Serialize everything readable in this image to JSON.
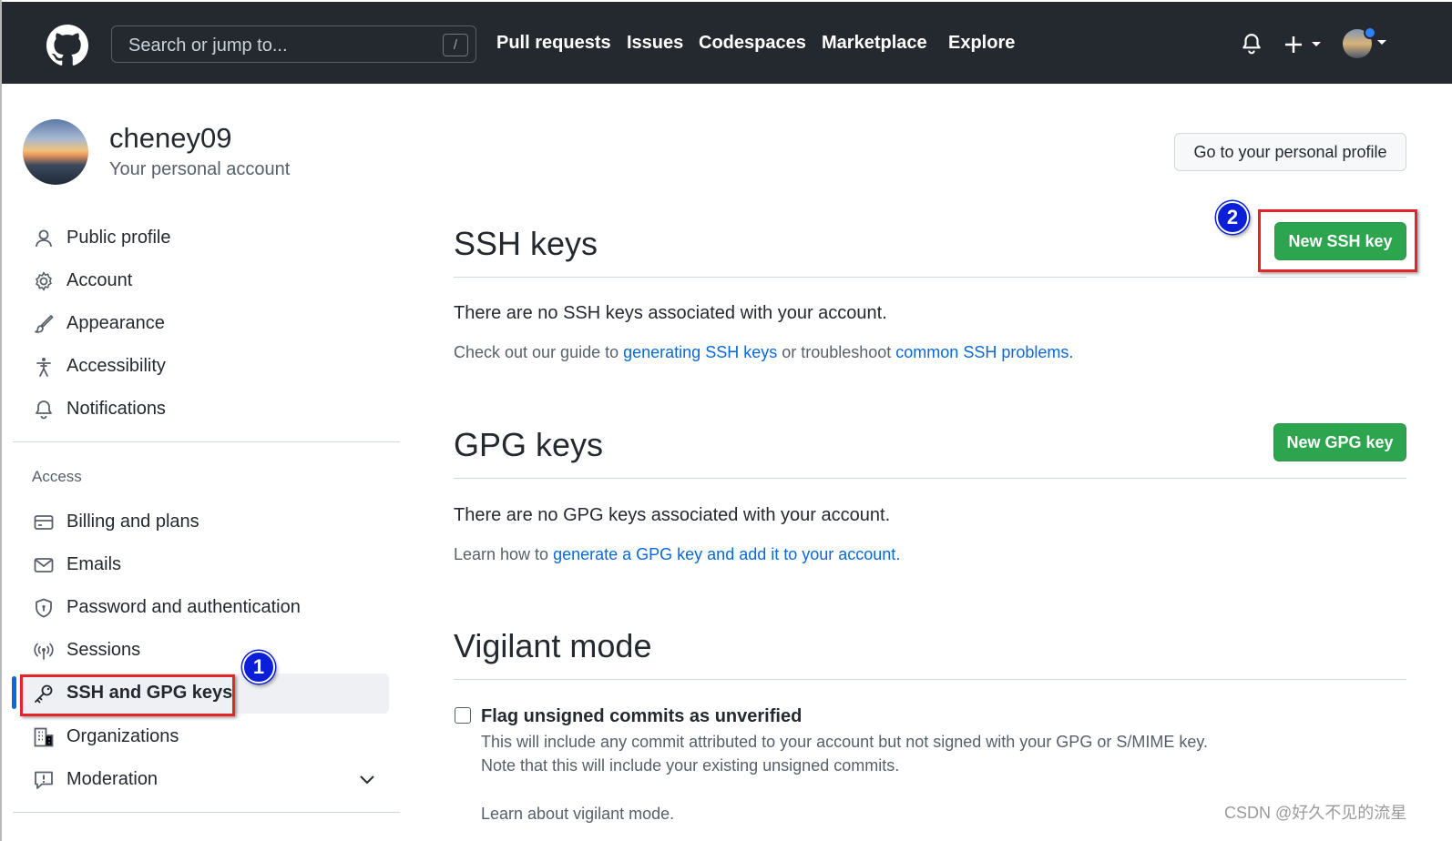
{
  "header": {
    "search_placeholder": "Search or jump to...",
    "search_shortcut": "/",
    "nav": [
      "Pull requests",
      "Issues",
      "Codespaces",
      "Marketplace",
      "Explore"
    ]
  },
  "profile": {
    "username": "cheney09",
    "subtitle": "Your personal account",
    "profile_button": "Go to your personal profile"
  },
  "sidebar": {
    "items": [
      {
        "label": "Public profile",
        "icon": "person-icon"
      },
      {
        "label": "Account",
        "icon": "gear-icon"
      },
      {
        "label": "Appearance",
        "icon": "paintbrush-icon"
      },
      {
        "label": "Accessibility",
        "icon": "accessibility-icon"
      },
      {
        "label": "Notifications",
        "icon": "bell-icon"
      }
    ],
    "section_access": "Access",
    "access_items": [
      {
        "label": "Billing and plans",
        "icon": "credit-card-icon"
      },
      {
        "label": "Emails",
        "icon": "mail-icon"
      },
      {
        "label": "Password and authentication",
        "icon": "shield-icon"
      },
      {
        "label": "Sessions",
        "icon": "broadcast-icon"
      },
      {
        "label": "SSH and GPG keys",
        "icon": "key-icon",
        "active": true
      },
      {
        "label": "Organizations",
        "icon": "organization-icon"
      },
      {
        "label": "Moderation",
        "icon": "report-icon"
      }
    ]
  },
  "ssh": {
    "title": "SSH keys",
    "new_button": "New SSH key",
    "empty": "There are no SSH keys associated with your account.",
    "guide_prefix": "Check out our guide to ",
    "guide_link1": "generating SSH keys",
    "guide_middle": " or troubleshoot ",
    "guide_link2": "common SSH problems",
    "guide_suffix": "."
  },
  "gpg": {
    "title": "GPG keys",
    "new_button": "New GPG key",
    "empty": "There are no GPG keys associated with your account.",
    "learn_prefix": "Learn how to ",
    "learn_link": "generate a GPG key and add it to your account",
    "learn_suffix": "."
  },
  "vigilant": {
    "title": "Vigilant mode",
    "checkbox_label": "Flag unsigned commits as unverified",
    "note1": "This will include any commit attributed to your account but not signed with your GPG or S/MIME key.",
    "note2": "Note that this will include your existing unsigned commits.",
    "learn_link": "Learn about vigilant mode."
  },
  "annotations": {
    "badge1": "1",
    "badge2": "2"
  },
  "watermark": "CSDN @好久不见的流星",
  "colors": {
    "header_bg": "#24292f",
    "green": "#2da44e",
    "link": "#0969da",
    "annotation_red": "#e3242b",
    "badge_blue": "#0b1fd9"
  }
}
